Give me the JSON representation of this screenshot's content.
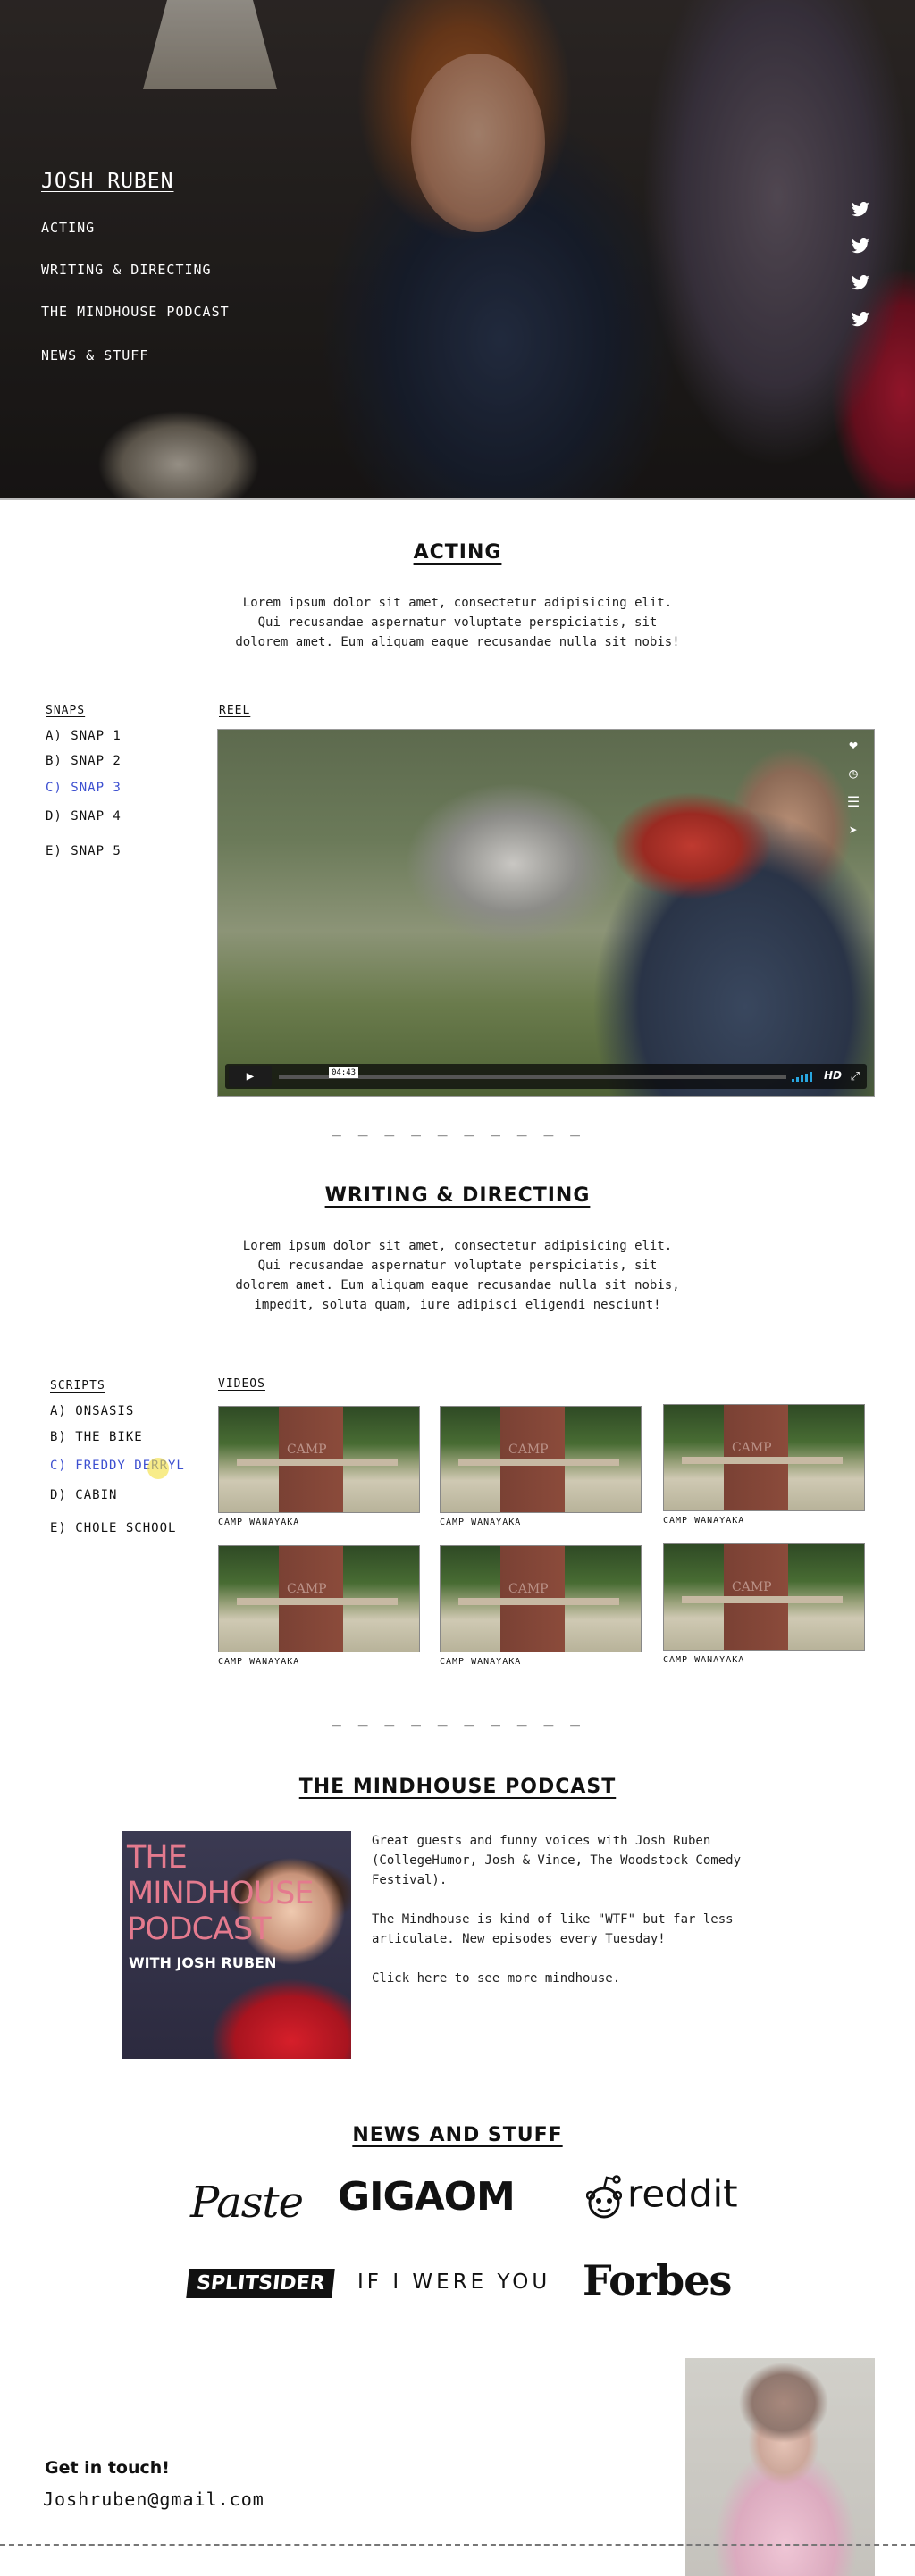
{
  "header": {
    "site_title": "JOSH RUBEN",
    "nav": [
      "ACTING",
      "WRITING & DIRECTING",
      "THE MINDHOUSE PODCAST",
      "NEWS & STUFF"
    ],
    "social_icons": [
      "twitter-icon",
      "twitter-icon",
      "twitter-icon",
      "twitter-icon"
    ]
  },
  "acting": {
    "heading": "ACTING",
    "blurb": "Lorem ipsum dolor sit amet, consectetur adipisicing elit. Qui recusandae aspernatur voluptate perspiciatis, sit dolorem amet. Eum aliquam eaque recusandae nulla sit nobis!",
    "snaps_label": "SNAPS",
    "snaps": [
      "A) SNAP 1",
      "B) SNAP 2",
      "C) SNAP 3",
      "D) SNAP 4",
      "E) SNAP 5"
    ],
    "active_snap": 2,
    "reel_label": "REEL",
    "video": {
      "time": "04:43",
      "hd": "HD",
      "side_icons": [
        "heart-icon",
        "clock-icon",
        "layers-icon",
        "send-icon"
      ]
    }
  },
  "divider": "_ _ _ _ _ _ _ _ _ _",
  "writing": {
    "heading": "WRITING & DIRECTING",
    "blurb": "Lorem ipsum dolor sit amet, consectetur adipisicing elit. Qui recusandae aspernatur voluptate perspiciatis, sit dolorem amet. Eum aliquam eaque recusandae nulla sit nobis, impedit, soluta quam, iure adipisci eligendi nesciunt!",
    "scripts_label": "SCRIPTS",
    "scripts": [
      "A) ONSASIS",
      "B) THE BIKE",
      "C) FREDDY DERRYL",
      "D) CABIN",
      "E) CHOLE SCHOOL"
    ],
    "active_script": 2,
    "videos_label": "VIDEOS",
    "videos": [
      "CAMP WANAYAKA",
      "CAMP WANAYAKA",
      "CAMP WANAYAKA",
      "CAMP WANAYAKA",
      "CAMP WANAYAKA",
      "CAMP WANAYAKA"
    ]
  },
  "podcast": {
    "heading": "THE MINDHOUSE PODCAST",
    "art_title": "THE MINDHOUSE PODCAST",
    "art_sub": "WITH JOSH RUBEN",
    "p1": "Great guests and funny voices with Josh Ruben (CollegeHumor, Josh & Vince, The Woodstock Comedy Festival).",
    "p2": "The Mindhouse is kind of like \"WTF\" but far less articulate.  New episodes every Tuesday!",
    "p3": "Click here to see more mindhouse."
  },
  "news": {
    "heading": "NEWS AND STUFF",
    "logos": [
      "Paste",
      "GIGAOM",
      "reddit",
      "SPLITSIDER",
      "IF I WERE YOU",
      "Forbes"
    ]
  },
  "contact": {
    "title": "Get in touch!",
    "email": "Joshruben@gmail.com"
  },
  "colors": {
    "accent_link": "#3c4fd0",
    "text": "#111111",
    "highlight": "#f3df3a"
  }
}
